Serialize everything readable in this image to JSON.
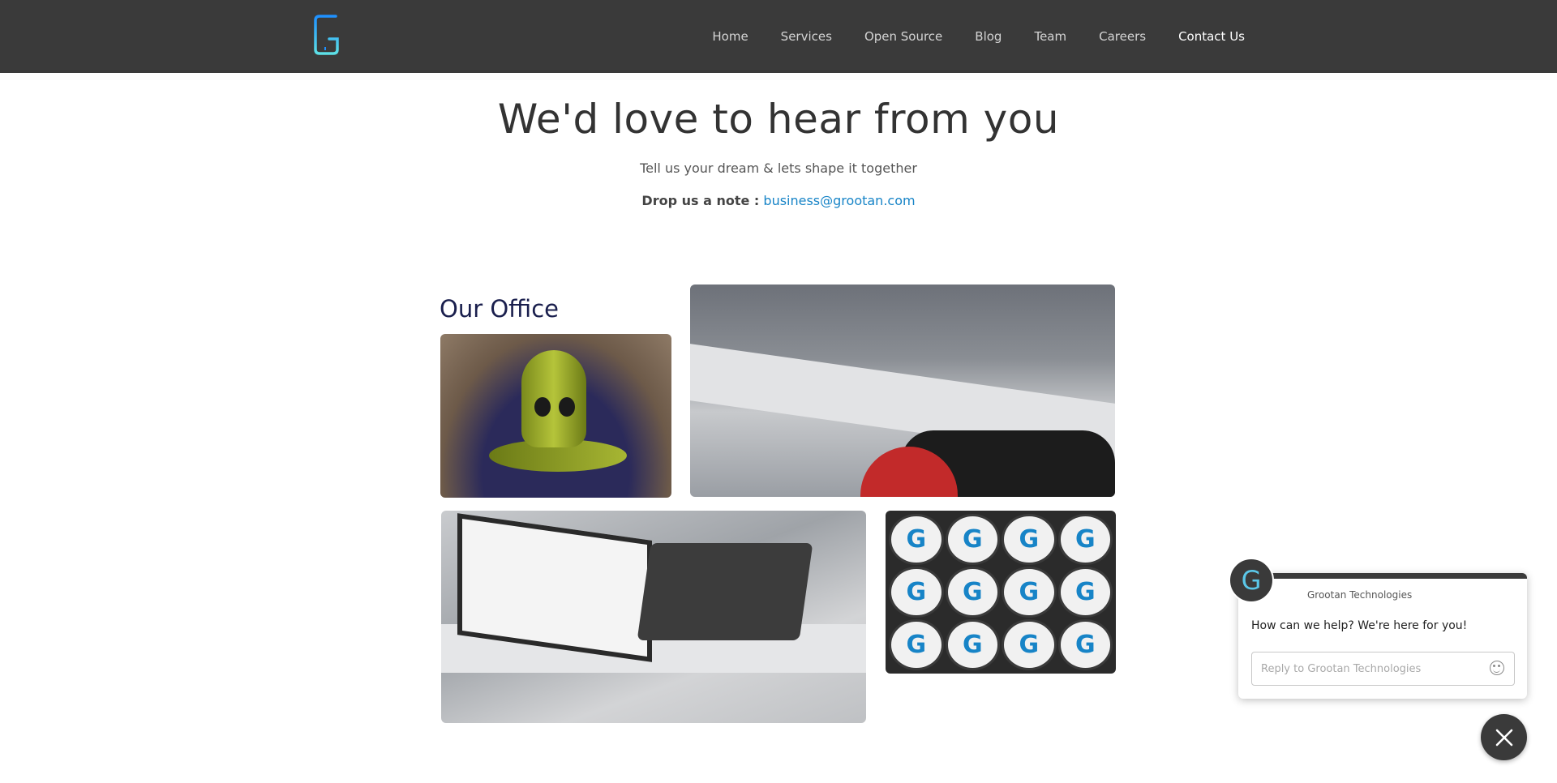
{
  "nav": {
    "logo_icon": "grootan-g-logo-icon",
    "items": [
      "Home",
      "Services",
      "Open Source",
      "Blog",
      "Team",
      "Careers",
      "Contact Us"
    ],
    "active": "Contact Us"
  },
  "hero": {
    "title": "We'd love to hear from you",
    "subtitle": "Tell us your dream & lets shape it together",
    "note_label": "Drop us a note :",
    "email": "business@grootan.com"
  },
  "office": {
    "title": "Our Office",
    "cupcake_letter": "G"
  },
  "chat": {
    "company_name": "Grootan Technologies",
    "message": "How can we help? We're here for you!",
    "input_placeholder": "Reply to Grootan Technologies",
    "avatar_letter": "G"
  },
  "colors": {
    "navbar": "#3a3a3a",
    "link": "#1784c7",
    "logo_gradient": [
      "#1e90ff",
      "#5de0e6"
    ]
  }
}
